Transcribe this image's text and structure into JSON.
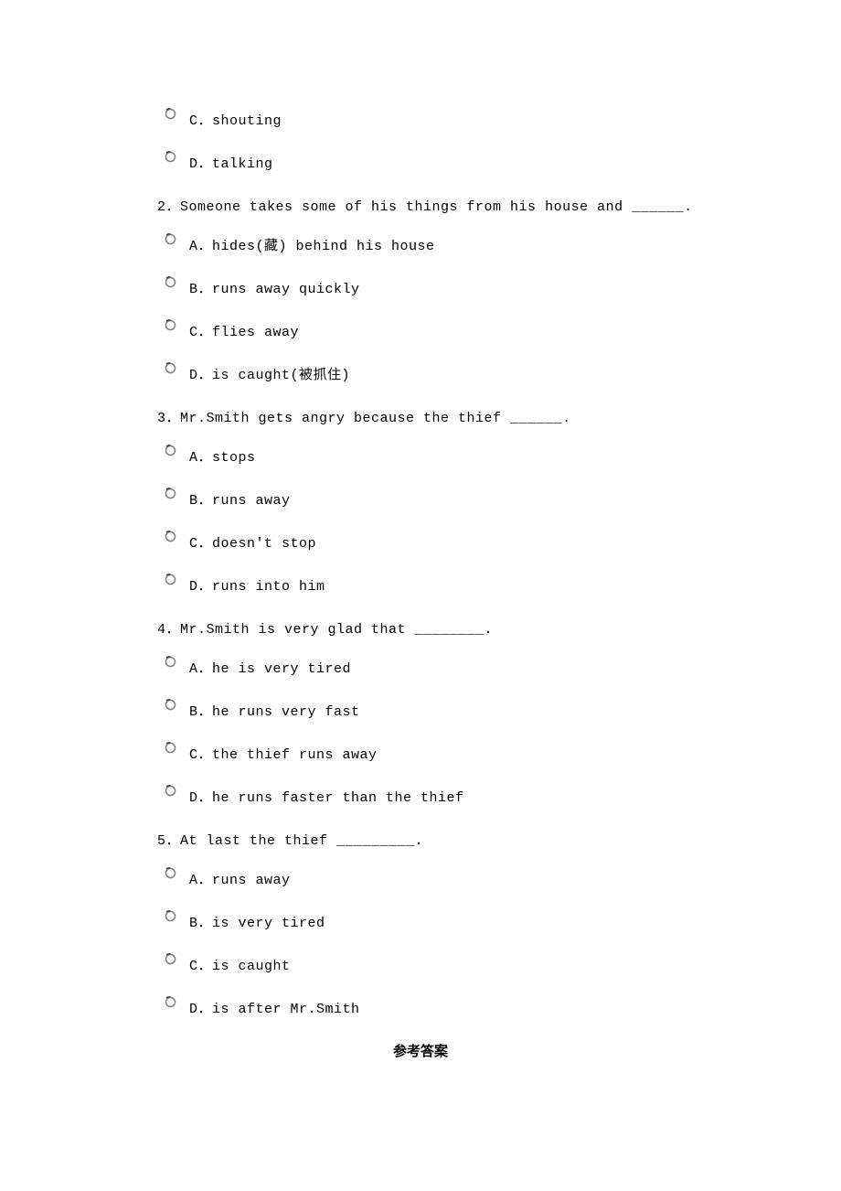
{
  "orphan_options": [
    {
      "label": "C．shouting"
    },
    {
      "label": "D．talking"
    }
  ],
  "questions": [
    {
      "stem": "2．Someone takes some of his things from his house and ______.",
      "options": [
        {
          "label": "A．hides(藏) behind his house"
        },
        {
          "label": "B．runs away quickly"
        },
        {
          "label": "C．flies away"
        },
        {
          "label": "D．is caught(被抓住)"
        }
      ]
    },
    {
      "stem": "3．Mr.Smith gets angry because the thief ______.",
      "options": [
        {
          "label": "A．stops"
        },
        {
          "label": "B．runs away"
        },
        {
          "label": "C．doesn't stop"
        },
        {
          "label": "D．runs into him"
        }
      ]
    },
    {
      "stem": "4．Mr.Smith is very glad that ________.",
      "options": [
        {
          "label": "A．he is very tired"
        },
        {
          "label": "B．he runs very fast"
        },
        {
          "label": "C．the thief runs away"
        },
        {
          "label": "D．he runs faster than the thief"
        }
      ]
    },
    {
      "stem": "5．At last the thief _________.",
      "options": [
        {
          "label": "A．runs away"
        },
        {
          "label": "B．is very tired"
        },
        {
          "label": "C．is caught"
        },
        {
          "label": "D．is after Mr.Smith"
        }
      ]
    }
  ],
  "answer_heading": "参考答案"
}
